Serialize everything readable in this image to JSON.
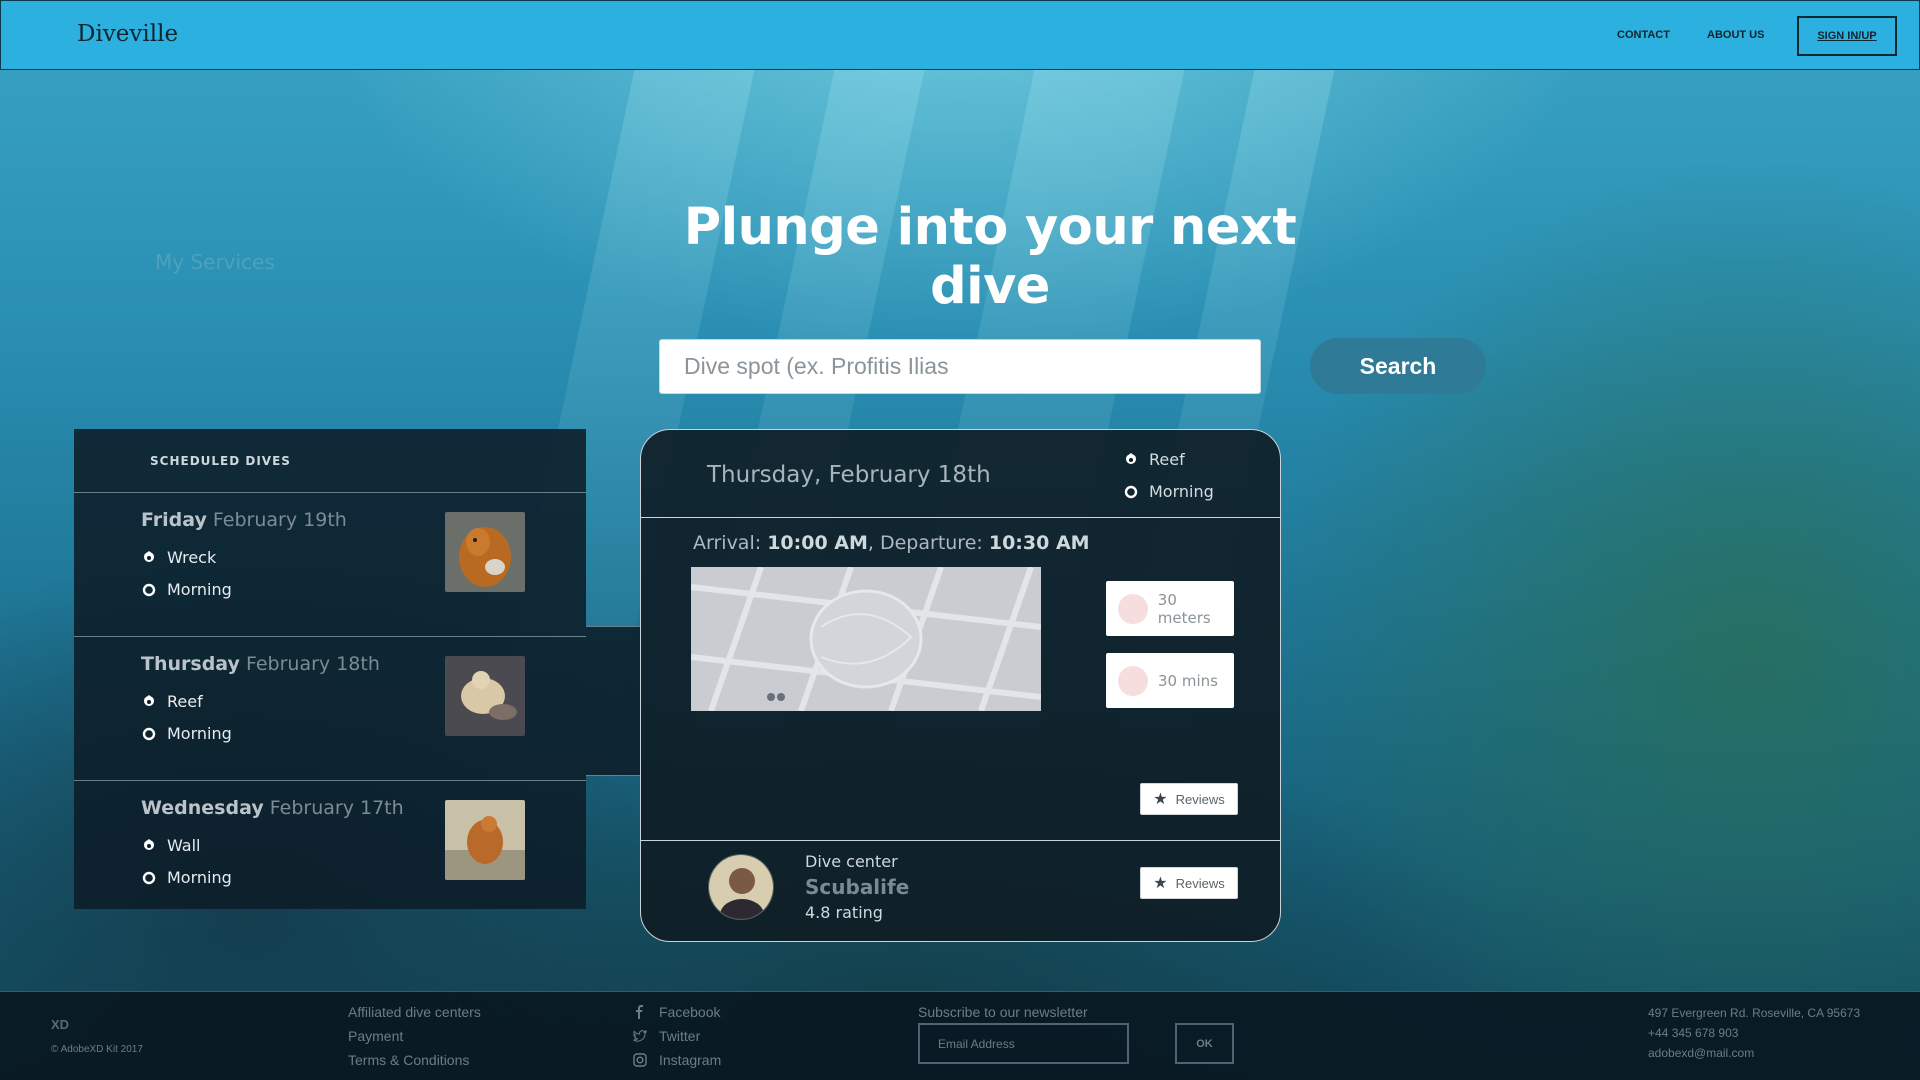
{
  "header": {
    "brand": "Diveville",
    "nav": {
      "contact": "CONTACT",
      "about": "ABOUT US",
      "signin": "SIGN IN/UP"
    }
  },
  "ghost_text": "My Services",
  "hero": {
    "title": "Plunge into your next dive"
  },
  "search": {
    "placeholder": "Dive spot (ex. Profitis Ilias",
    "button": "Search"
  },
  "scheduled": {
    "title": "SCHEDULED DIVES",
    "items": [
      {
        "day": "Friday",
        "date": "February 19th",
        "type": "Wreck",
        "time": "Morning"
      },
      {
        "day": "Thursday",
        "date": "February 18th",
        "type": "Reef",
        "time": "Morning"
      },
      {
        "day": "Wednesday",
        "date": "February 17th",
        "type": "Wall",
        "time": "Morning"
      }
    ]
  },
  "detail": {
    "date": "Thursday, February 18th",
    "type": "Reef",
    "time": "Morning",
    "arrival_label": "Arrival:",
    "arrival_time": "10:00 AM",
    "departure_label": ", Departure:",
    "departure_time": "10:30 AM",
    "depth": "30 meters",
    "duration": "30 mins",
    "reviews_label": "Reviews",
    "center": {
      "label": "Dive center",
      "name": "Scubalife",
      "rating": "4.8 rating",
      "reviews_label": "Reviews"
    }
  },
  "footer": {
    "xd": "XD",
    "copyright": "© AdobeXD Kit 2017",
    "links": [
      "Affiliated dive centers",
      "Payment",
      "Terms & Conditions"
    ],
    "social": [
      "Facebook",
      "Twitter",
      "Instagram"
    ],
    "newsletter_label": "Subscribe to our newsletter",
    "email_placeholder": "Email Address",
    "ok": "OK",
    "contact": [
      "497 Evergreen Rd. Roseville, CA 95673",
      "+44 345 678 903",
      "adobexd@mail.com"
    ]
  },
  "colors": {
    "header": "#2cb0e0",
    "button": "#2f7a96",
    "panel": "#0c1c28"
  }
}
